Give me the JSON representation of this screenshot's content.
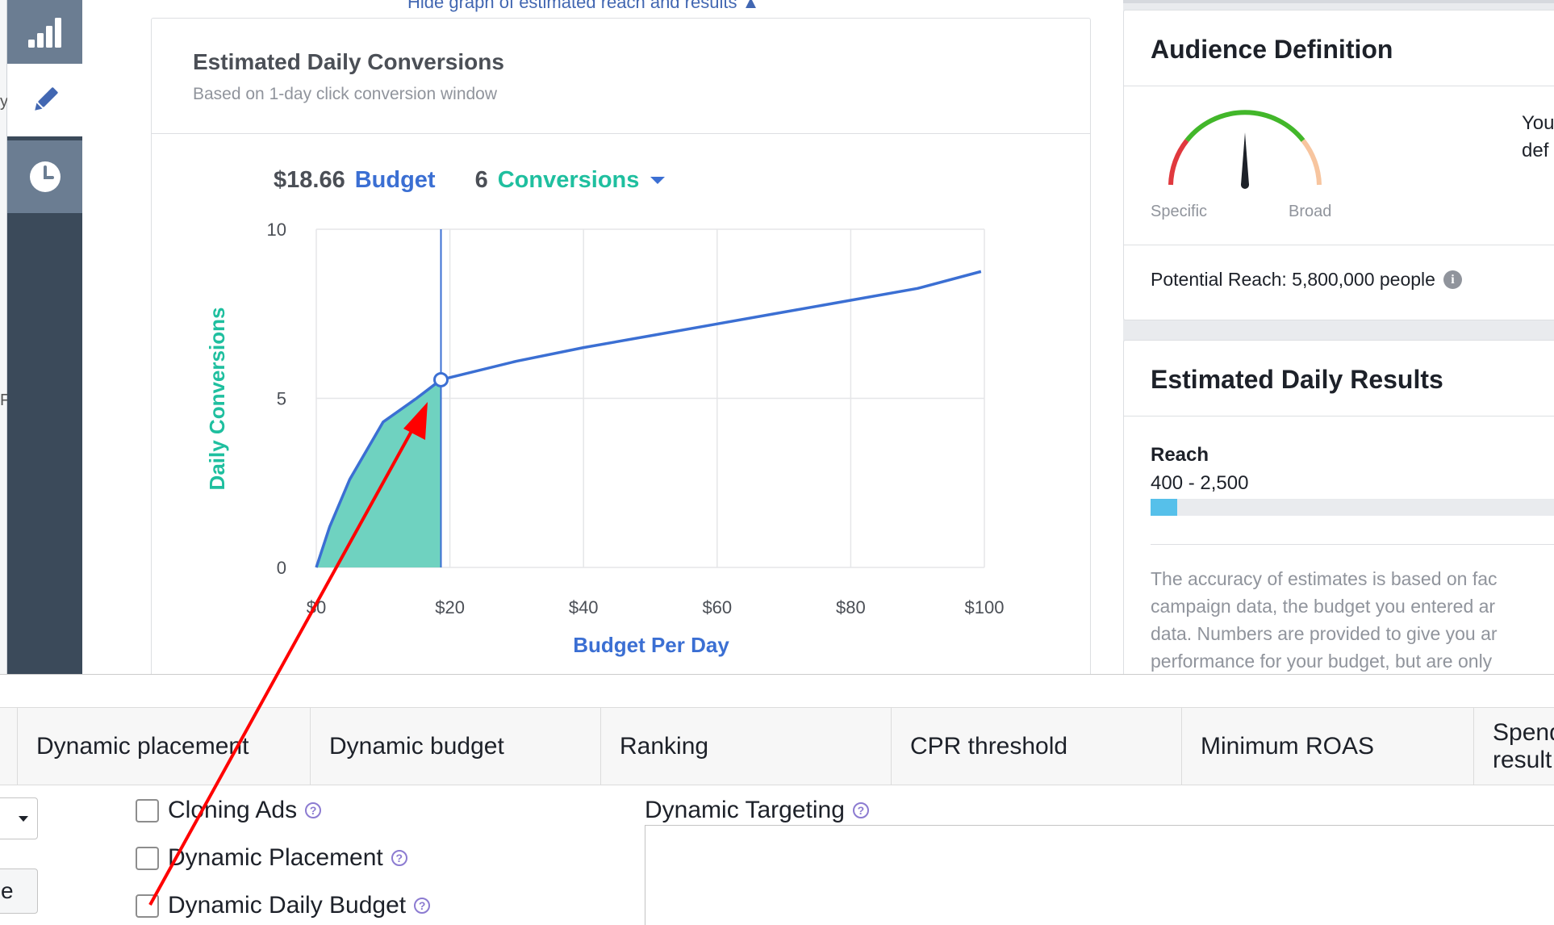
{
  "colors": {
    "accent_blue": "#3b6fd3",
    "conversions_teal": "#1fbf9f",
    "area_fill": "#6fd2c0",
    "rail_dark": "#3b4a5a",
    "rail_tile": "#6b7d92",
    "annotation_arrow": "#ff0000",
    "gauge_green": "#42b72a",
    "gauge_red": "#e0393e",
    "gauge_peach": "#f7c59f",
    "reach_bar": "#56c0ea"
  },
  "rail": {
    "icons": [
      "bar-chart-icon",
      "pencil-icon",
      "clock-icon"
    ],
    "active": "pencil-icon"
  },
  "header": {
    "toggle_link": "Hide graph of estimated reach and results ▲"
  },
  "card": {
    "title": "Estimated Daily Conversions",
    "subtitle": "Based on 1-day click conversion window",
    "budget_amount": "$18.66",
    "budget_label": "Budget",
    "conversions_count": "6",
    "conversions_label": "Conversions"
  },
  "chart_data": {
    "type": "area",
    "title": "",
    "xlabel": "Budget Per Day",
    "ylabel": "Daily Conversions",
    "xlim": [
      0,
      100
    ],
    "ylim": [
      0,
      10
    ],
    "x_ticks": [
      0,
      20,
      40,
      60,
      80,
      100
    ],
    "x_tick_labels": [
      "$0",
      "$20",
      "$40",
      "$60",
      "$80",
      "$100"
    ],
    "y_ticks": [
      0,
      5,
      10
    ],
    "y_tick_labels": [
      "0",
      "5",
      "10"
    ],
    "grid": true,
    "series": [
      {
        "x": [
          0,
          2,
          5,
          10,
          15,
          18.66,
          30,
          40,
          50,
          60,
          70,
          80,
          90,
          99.5
        ],
        "y": [
          0,
          1.2,
          2.6,
          4.3,
          5.0,
          5.55,
          6.1,
          6.5,
          6.85,
          7.2,
          7.55,
          7.9,
          8.25,
          8.75
        ]
      }
    ],
    "shaded_to_x": 18.66,
    "marker": {
      "x": 18.66,
      "y": 5.55
    }
  },
  "audience": {
    "title": "Audience Definition",
    "gauge_left": "Specific",
    "gauge_right": "Broad",
    "side_line1": "You",
    "side_line2": "def",
    "potential_reach": "Potential Reach: 5,800,000 people",
    "info_icon": "i",
    "gauge_needle_fraction": 0.5
  },
  "estimated": {
    "title": "Estimated Daily Results",
    "reach_label": "Reach",
    "reach_range": "400 - 2,500",
    "reach_fill_fraction": 0.066,
    "accuracy_lines": [
      "The accuracy of estimates is based on fac",
      "campaign data, the budget you entered ar",
      "data. Numbers are provided to give you ar",
      "performance for your budget, but are only"
    ]
  },
  "tabs": [
    {
      "label": "Dynamic placement"
    },
    {
      "label": "Dynamic budget"
    },
    {
      "label": "Ranking"
    },
    {
      "label": "CPR threshold"
    },
    {
      "label": "Minimum ROAS"
    },
    {
      "label_line1": "Spend",
      "label_line2": "result"
    }
  ],
  "form": {
    "button_fragment": "e",
    "checkboxes": [
      {
        "label": "Cloning Ads",
        "checked": false
      },
      {
        "label": "Dynamic Placement",
        "checked": false
      },
      {
        "label": "Dynamic Daily Budget",
        "checked": false
      }
    ],
    "help_glyph": "?",
    "dynamic_targeting_label": "Dynamic Targeting"
  }
}
